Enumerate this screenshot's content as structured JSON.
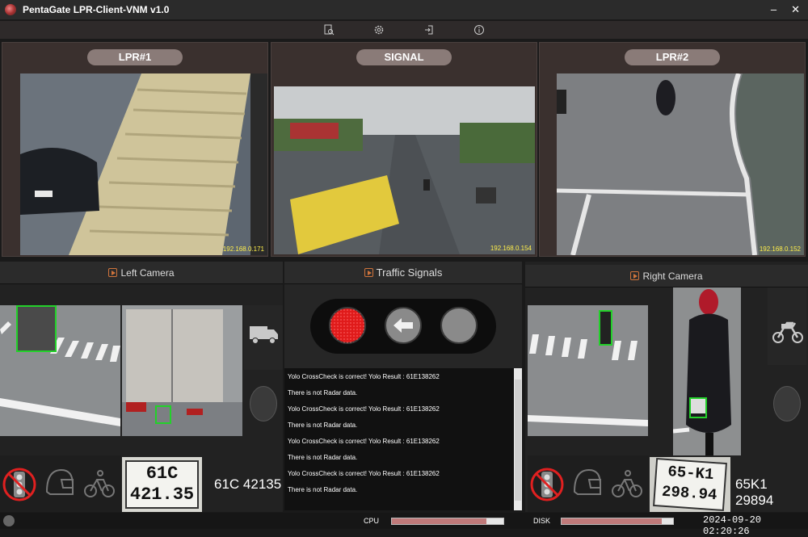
{
  "window": {
    "title": "PentaGate  LPR-Client-VNM v1.0",
    "minimize": "–",
    "close": "✕"
  },
  "toolbar": {
    "icons": [
      "search-document-icon",
      "gear-icon",
      "logout-icon",
      "info-icon"
    ]
  },
  "cameras": {
    "lpr1": {
      "label": "LPR#1",
      "ip": "192.168.0.171"
    },
    "signal": {
      "label": "SIGNAL",
      "ip": "192.168.0.154"
    },
    "lpr2": {
      "label": "LPR#2",
      "ip": "192.168.0.152"
    }
  },
  "left_camera": {
    "title": "Left Camera",
    "vehicle_icon": "truck-icon",
    "plate_image_text": [
      "61C",
      "421.35"
    ],
    "plate_number": "61C 42135",
    "indicator_icons": [
      "no-traffic-light-icon",
      "helmet-icon",
      "bicycle-icon"
    ]
  },
  "traffic_signals": {
    "title": "Traffic Signals",
    "lights": [
      {
        "name": "red-light",
        "state": "on",
        "color": "#e01b1b"
      },
      {
        "name": "left-arrow-light",
        "state": "off",
        "color": "#8a8a8a"
      },
      {
        "name": "green-light",
        "state": "off",
        "color": "#8a8a8a"
      }
    ]
  },
  "log": [
    "Yolo CrossCheck is correct! Yolo Result : 61E138262",
    "There is not Radar data.",
    "Yolo CrossCheck is correct! Yolo Result : 61E138262",
    "There is not Radar data.",
    "Yolo CrossCheck is correct! Yolo Result : 61E138262",
    "There is not Radar data.",
    "Yolo CrossCheck is correct! Yolo Result : 61E138262",
    "There is not Radar data."
  ],
  "right_camera": {
    "title": "Right Camera",
    "vehicle_icon": "motorbike-icon",
    "plate_image_text": [
      "65-K1",
      "298.94"
    ],
    "plate_number": "65K1 29894",
    "indicator_icons": [
      "no-traffic-light-icon",
      "helmet-icon",
      "bicycle-icon"
    ]
  },
  "status": {
    "cpu_label": "CPU",
    "cpu_usage": 0.85,
    "disk_label": "DISK",
    "disk_usage": 0.9,
    "datetime": "2024-09-20 02:20:26"
  },
  "colors": {
    "detection_box": "#23d12a",
    "ip_text": "#ffef4a",
    "prohibit": "#e02020"
  }
}
